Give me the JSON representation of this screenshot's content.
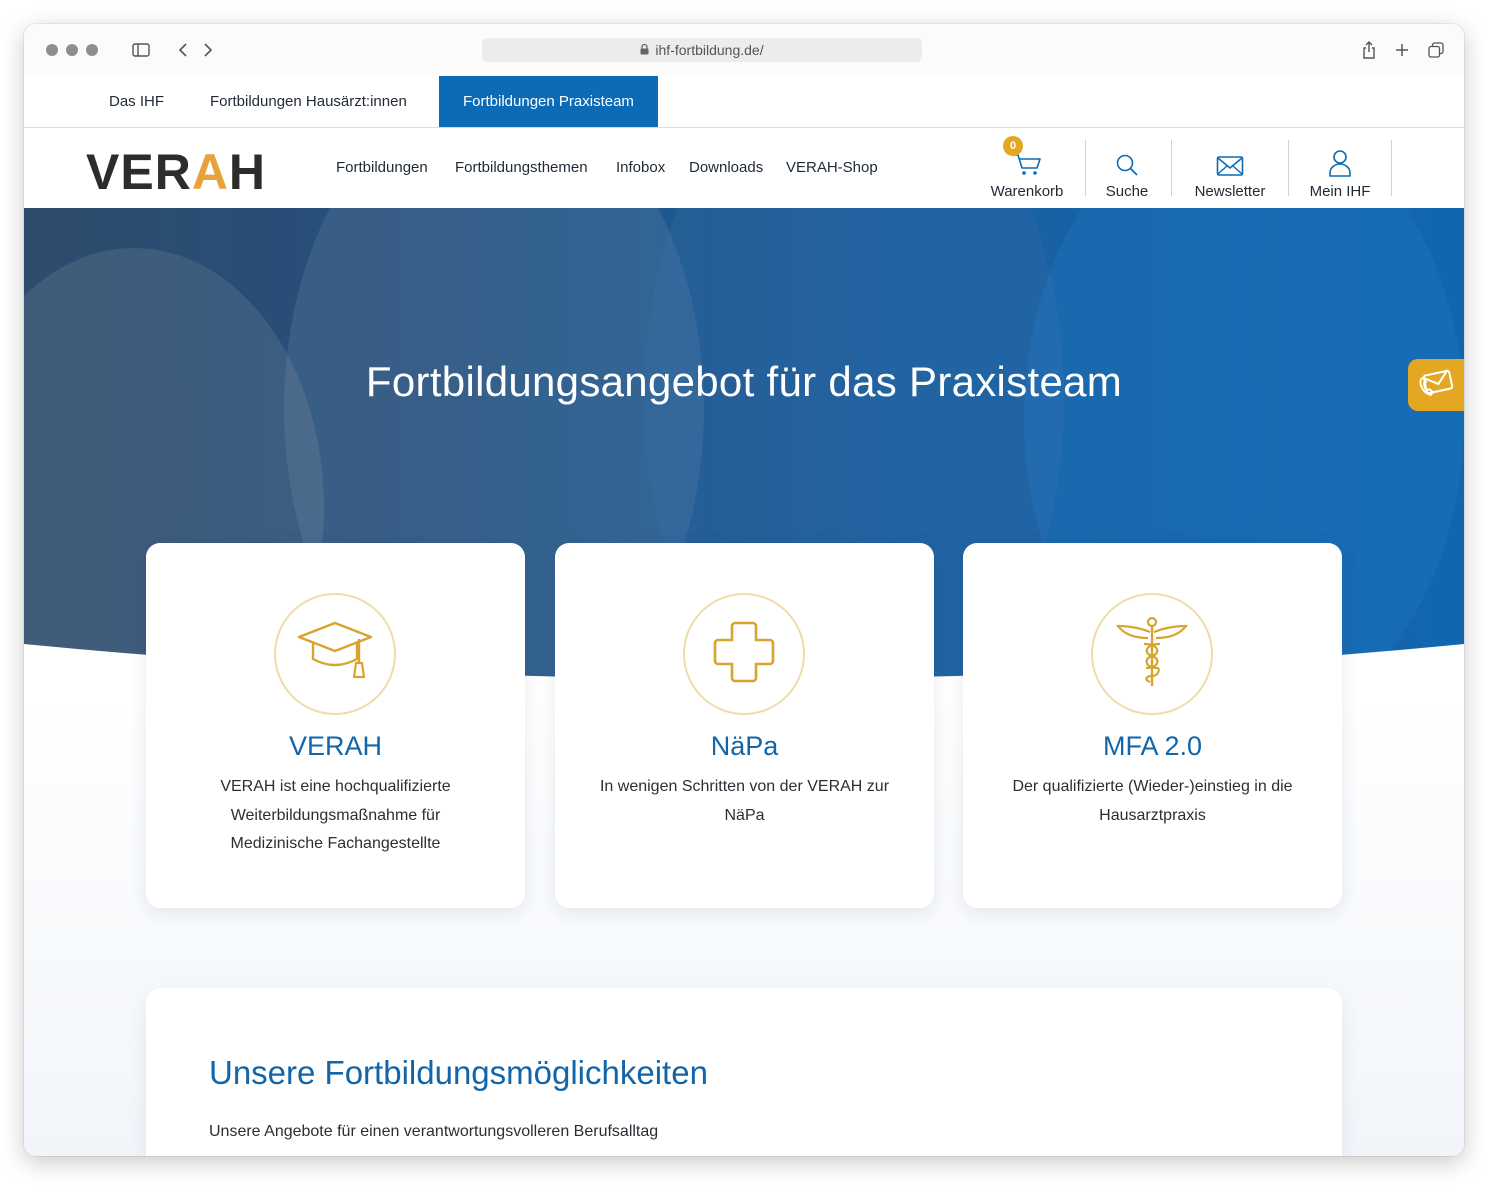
{
  "browser": {
    "url": "ihf-fortbildung.de/"
  },
  "top_tabs": [
    {
      "label": "Das IHF",
      "active": false
    },
    {
      "label": "Fortbildungen Hausärzt:innen",
      "active": false
    },
    {
      "label": "Fortbildungen Praxisteam",
      "active": true
    }
  ],
  "header": {
    "logo_left": "VER",
    "logo_accent": "A",
    "logo_right": "H",
    "nav": [
      "Fortbildungen",
      "Fortbildungsthemen",
      "Infobox",
      "Downloads",
      "VERAH-Shop"
    ],
    "cart_label": "Warenkorb",
    "cart_count": "0",
    "search_label": "Suche",
    "newsletter_label": "Newsletter",
    "account_label": "Mein IHF"
  },
  "hero": {
    "title": "Fortbildungsangebot für das Praxisteam"
  },
  "cards": [
    {
      "icon": "graduation-cap-icon",
      "title": "VERAH",
      "desc": "VERAH ist eine hochqualifizierte Weiterbildungsmaßnahme für Medizinische Fachangestellte"
    },
    {
      "icon": "medical-cross-icon",
      "title": "NäPa",
      "desc": "In wenigen Schritten von der VERAH zur NäPa"
    },
    {
      "icon": "caduceus-icon",
      "title": "MFA 2.0",
      "desc": "Der qualifizierte (Wieder-)einstieg in die Hausarztpraxis"
    }
  ],
  "section": {
    "title": "Unsere Fortbildungsmöglichkeiten",
    "subtitle": "Unsere Angebote für einen verantwortungsvolleren Berufsalltag"
  },
  "colors": {
    "brand_blue": "#0b6bb6",
    "accent_gold": "#e3a721"
  }
}
